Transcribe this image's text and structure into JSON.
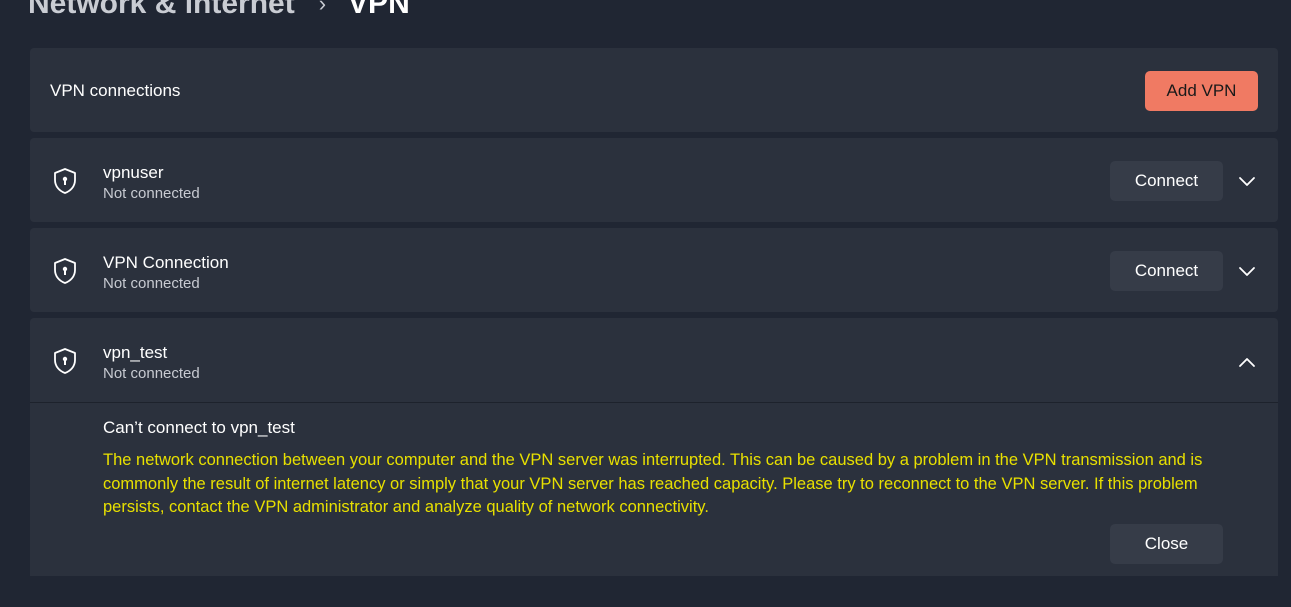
{
  "breadcrumb": {
    "parent": "Network & internet",
    "separator": "›",
    "current": "VPN"
  },
  "header": {
    "title": "VPN connections",
    "add_button": "Add VPN"
  },
  "connections": [
    {
      "name": "vpnuser",
      "status": "Not connected",
      "action": "Connect",
      "icon": "shield-icon",
      "chevron": "chevron-down-icon"
    },
    {
      "name": "VPN Connection",
      "status": "Not connected",
      "action": "Connect",
      "icon": "shield-icon",
      "chevron": "chevron-down-icon"
    },
    {
      "name": "vpn_test",
      "status": "Not connected",
      "icon": "shield-icon",
      "chevron": "chevron-up-icon",
      "error": {
        "title": "Can’t connect to vpn_test",
        "message": "The network connection between your computer and the VPN server was interrupted.  This can be caused by a problem in the VPN transmission and is commonly the result of internet latency or simply that your VPN server has reached capacity.  Please try to reconnect to the VPN server.  If this problem persists, contact the VPN administrator and analyze quality of network connectivity.",
        "close_button": "Close"
      }
    }
  ],
  "colors": {
    "background": "#202633",
    "card": "#2b313d",
    "accent": "#f07a63",
    "error_text": "#e8e000",
    "secondary_text": "#c7cad1"
  }
}
